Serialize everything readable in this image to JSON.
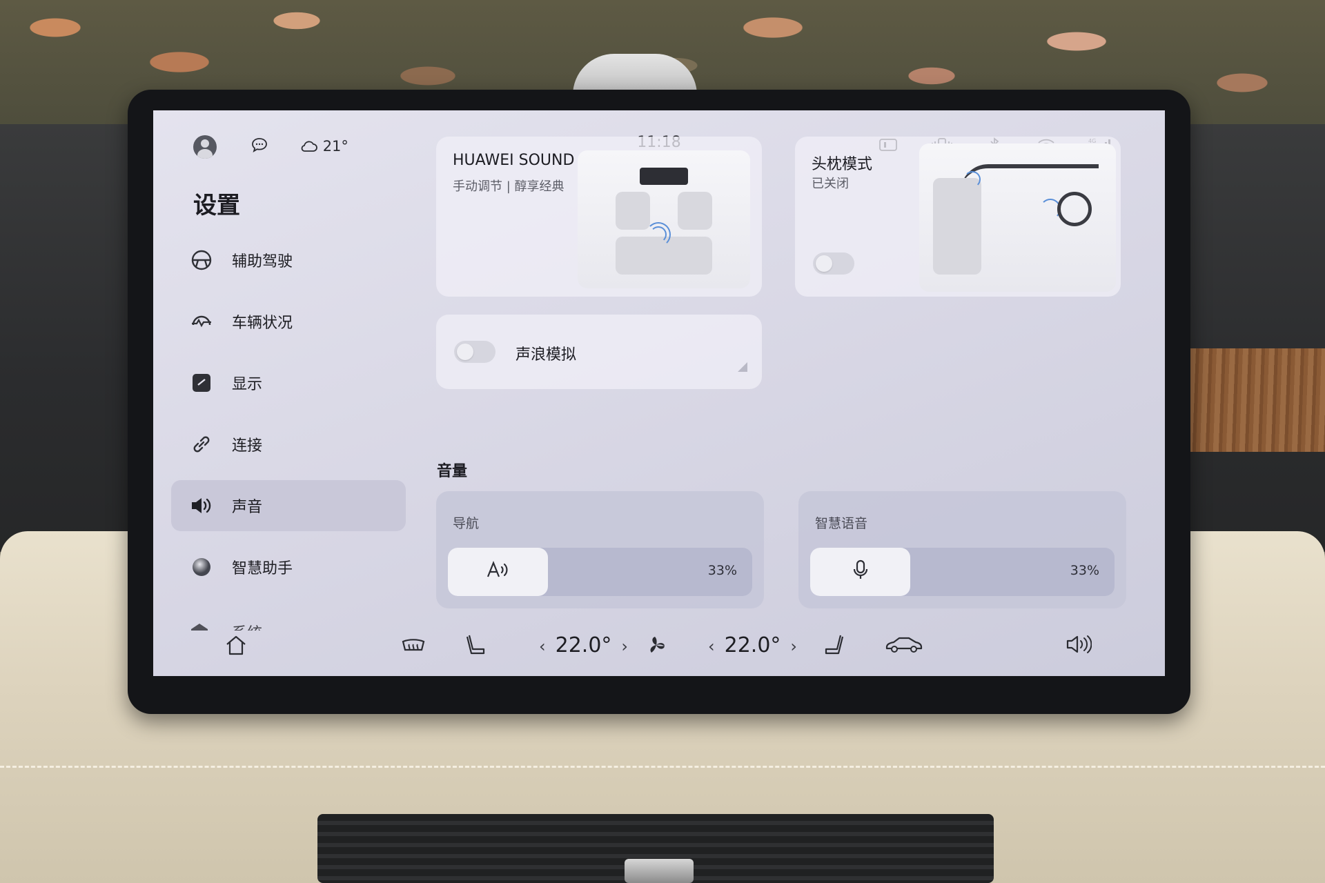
{
  "status_bar": {
    "weather": "21°",
    "time": "11:18",
    "icons": [
      "avatar",
      "message-icon",
      "weather-cloud-icon",
      "display-icon",
      "vibrate-icon",
      "bluetooth-icon",
      "wifi-icon",
      "signal-4g-icon"
    ]
  },
  "page": {
    "title": "设置"
  },
  "sidebar": {
    "items": [
      {
        "label": "辅助驾驶",
        "icon": "steering-wheel-icon"
      },
      {
        "label": "车辆状况",
        "icon": "vehicle-status-icon"
      },
      {
        "label": "显示",
        "icon": "display-brightness-icon"
      },
      {
        "label": "连接",
        "icon": "link-icon"
      },
      {
        "label": "声音",
        "icon": "speaker-icon",
        "active": true
      },
      {
        "label": "智慧助手",
        "icon": "assistant-icon"
      },
      {
        "label": "系统",
        "icon": "system-icon"
      }
    ]
  },
  "cards": {
    "huawei_sound": {
      "title": "HUAWEI SOUND",
      "subtitle": "手动调节 | 醇享经典"
    },
    "headrest": {
      "title": "头枕模式",
      "subtitle": "已关闭",
      "toggle_on": false
    },
    "sound_wave": {
      "label": "声浪模拟",
      "toggle_on": false
    }
  },
  "volume": {
    "section_title": "音量",
    "navigation": {
      "label": "导航",
      "value": "33%",
      "fraction": 0.33,
      "icon": "navigation-voice-icon"
    },
    "voice_assistant": {
      "label": "智慧语音",
      "value": "33%",
      "fraction": 0.33,
      "icon": "microphone-icon"
    }
  },
  "dock": {
    "left_temp": "22.0°",
    "right_temp": "22.0°",
    "icons": [
      "home-icon",
      "defrost-icon",
      "seat-left-icon",
      "fan-icon",
      "seat-right-icon",
      "car-icon",
      "volume-icon"
    ]
  }
}
